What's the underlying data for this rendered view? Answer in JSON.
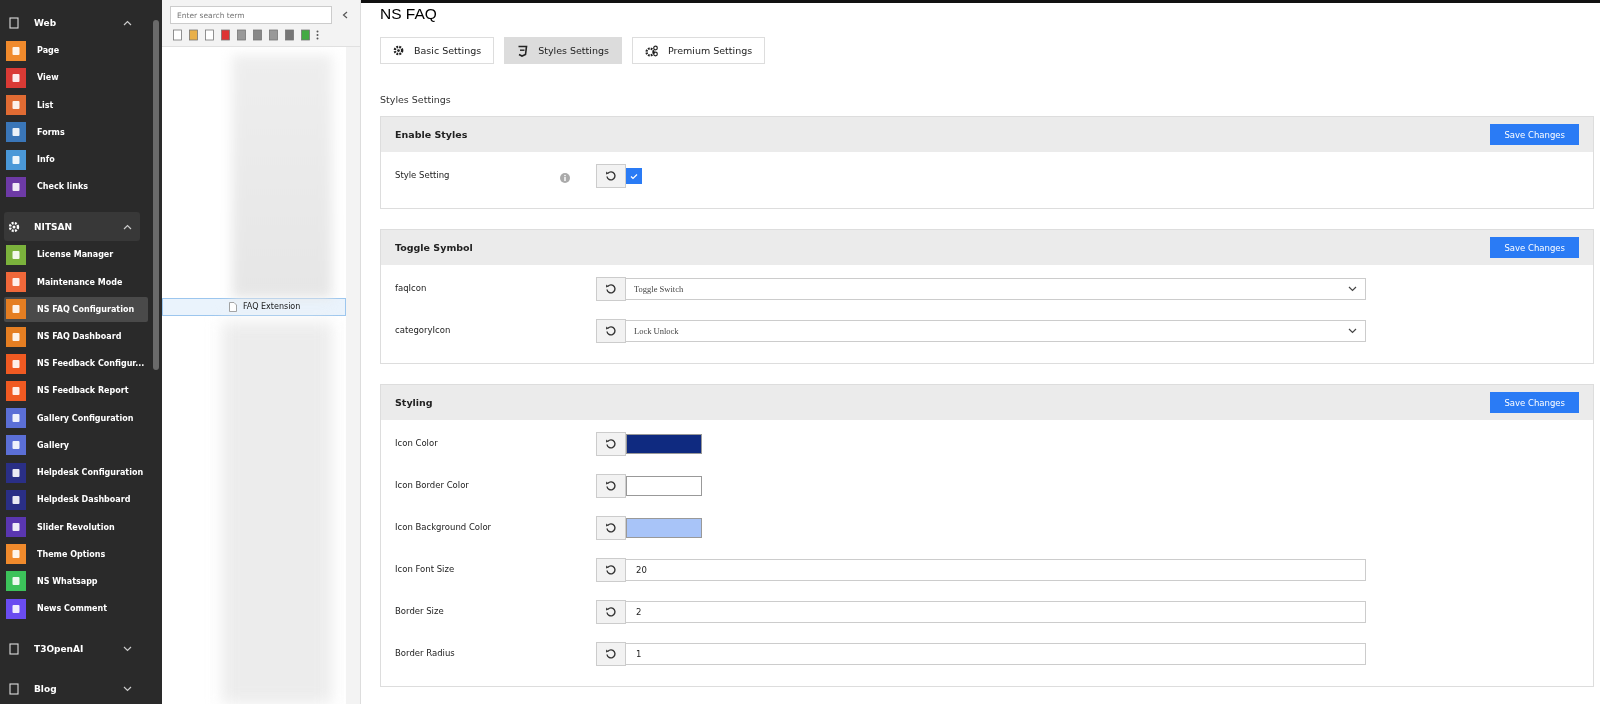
{
  "sidebar": {
    "groups": [
      {
        "title": "Web",
        "expanded": true,
        "items": [
          {
            "label": "Page",
            "color": "#f08a2c",
            "selected": false
          },
          {
            "label": "View",
            "color": "#d93a35",
            "selected": false
          },
          {
            "label": "List",
            "color": "#e06b33",
            "selected": false
          },
          {
            "label": "Forms",
            "color": "#3a76b8",
            "selected": false
          },
          {
            "label": "Info",
            "color": "#4a98d8",
            "selected": false
          },
          {
            "label": "Check links",
            "color": "#6d3aa6",
            "selected": false
          }
        ]
      },
      {
        "title": "NITSAN",
        "expanded": true,
        "items": [
          {
            "label": "License Manager",
            "color": "#7bb23c",
            "selected": false
          },
          {
            "label": "Maintenance Mode",
            "color": "#f0683a",
            "selected": false
          },
          {
            "label": "NS FAQ Configuration",
            "color": "#e57e22",
            "selected": true
          },
          {
            "label": "NS FAQ Dashboard",
            "color": "#e57e22",
            "selected": false
          },
          {
            "label": "NS Feedback Configur...",
            "color": "#f05a22",
            "selected": false
          },
          {
            "label": "NS Feedback Report",
            "color": "#f05a22",
            "selected": false
          },
          {
            "label": "Gallery Configuration",
            "color": "#5b6fd6",
            "selected": false
          },
          {
            "label": "Gallery",
            "color": "#5b6fd6",
            "selected": false
          },
          {
            "label": "Helpdesk Configuration",
            "color": "#2a2f86",
            "selected": false
          },
          {
            "label": "Helpdesk Dashboard",
            "color": "#2a2f86",
            "selected": false
          },
          {
            "label": "Slider Revolution",
            "color": "#5a36b0",
            "selected": false
          },
          {
            "label": "Theme Options",
            "color": "#f08a2c",
            "selected": false
          },
          {
            "label": "NS Whatsapp",
            "color": "#3cc25a",
            "selected": false
          },
          {
            "label": "News Comment",
            "color": "#6a4cf0",
            "selected": false
          }
        ]
      },
      {
        "title": "T3OpenAI",
        "expanded": false
      },
      {
        "title": "Blog",
        "expanded": false
      }
    ]
  },
  "page_tree": {
    "search": {
      "placeholder": "Enter search term"
    },
    "nodes": [
      {
        "label": "FAQ Extension",
        "selected": true
      }
    ]
  },
  "main": {
    "title": "NS FAQ",
    "tabs": [
      {
        "label": "Basic Settings",
        "selected": false
      },
      {
        "label": "Styles Settings",
        "selected": true
      },
      {
        "label": "Premium Settings",
        "selected": false
      }
    ],
    "section_title": "Styles Settings",
    "cards": [
      {
        "title": "Enable Styles",
        "button": "Save Changes",
        "fields": [
          {
            "kind": "checkbox",
            "label": "Style Setting",
            "info": true,
            "checked": true
          }
        ]
      },
      {
        "title": "Toggle Symbol",
        "button": "Save Changes",
        "fields": [
          {
            "kind": "select",
            "label": "faqIcon",
            "value": "Toggle Switch"
          },
          {
            "kind": "select",
            "label": "categoryIcon",
            "value": "Lock Unlock"
          }
        ]
      },
      {
        "title": "Styling",
        "button": "Save Changes",
        "fields": [
          {
            "kind": "color",
            "label": "Icon Color",
            "color": "#0f2a80"
          },
          {
            "kind": "color",
            "label": "Icon Border Color",
            "color": "#ffffff"
          },
          {
            "kind": "color",
            "label": "Icon Background Color",
            "color": "#a8c4f8"
          },
          {
            "kind": "text",
            "label": "Icon Font Size",
            "value": "20"
          },
          {
            "kind": "text",
            "label": "Border Size",
            "value": "2"
          },
          {
            "kind": "text",
            "label": "Border Radius",
            "value": "1"
          }
        ]
      }
    ]
  }
}
